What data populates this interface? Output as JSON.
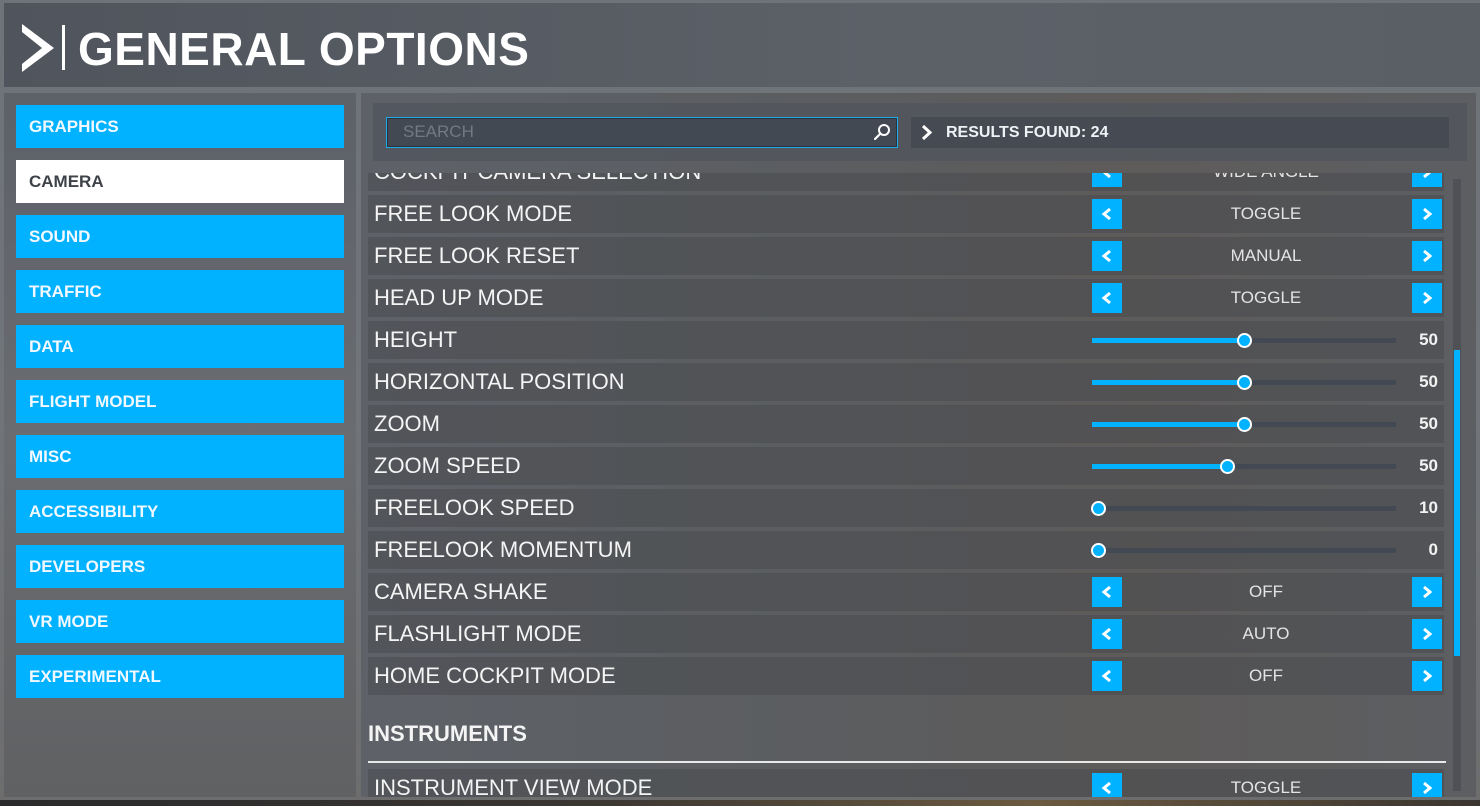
{
  "header": {
    "title": "GENERAL OPTIONS",
    "icon": "chevron-right-icon"
  },
  "sidebar": {
    "items": [
      {
        "label": "GRAPHICS",
        "active": false
      },
      {
        "label": "CAMERA",
        "active": true
      },
      {
        "label": "SOUND",
        "active": false
      },
      {
        "label": "TRAFFIC",
        "active": false
      },
      {
        "label": "DATA",
        "active": false
      },
      {
        "label": "FLIGHT MODEL",
        "active": false
      },
      {
        "label": "MISC",
        "active": false
      },
      {
        "label": "ACCESSIBILITY",
        "active": false
      },
      {
        "label": "DEVELOPERS",
        "active": false
      },
      {
        "label": "VR MODE",
        "active": false
      },
      {
        "label": "EXPERIMENTAL",
        "active": false
      }
    ]
  },
  "search": {
    "placeholder": "SEARCH",
    "value": "",
    "icon": "search-icon"
  },
  "results": {
    "label": "RESULTS FOUND: 24",
    "count": 24
  },
  "settings": [
    {
      "type": "choice",
      "label": "COCKPIT CAMERA SELECTION",
      "value": "WIDE ANGLE",
      "partial": true
    },
    {
      "type": "choice",
      "label": "FREE LOOK MODE",
      "value": "TOGGLE"
    },
    {
      "type": "choice",
      "label": "FREE LOOK RESET",
      "value": "MANUAL"
    },
    {
      "type": "choice",
      "label": "HEAD UP MODE",
      "value": "TOGGLE"
    },
    {
      "type": "slider",
      "label": "HEIGHT",
      "value": "50",
      "fraction": 0.5
    },
    {
      "type": "slider",
      "label": "HORIZONTAL POSITION",
      "value": "50",
      "fraction": 0.5
    },
    {
      "type": "slider",
      "label": "ZOOM",
      "value": "50",
      "fraction": 0.5
    },
    {
      "type": "slider",
      "label": "ZOOM SPEED",
      "value": "50",
      "fraction": 0.445
    },
    {
      "type": "slider",
      "label": "FREELOOK SPEED",
      "value": "10",
      "fraction": 0.02
    },
    {
      "type": "slider",
      "label": "FREELOOK MOMENTUM",
      "value": "0",
      "fraction": 0.02
    },
    {
      "type": "choice",
      "label": "CAMERA SHAKE",
      "value": "OFF"
    },
    {
      "type": "choice",
      "label": "FLASHLIGHT MODE",
      "value": "AUTO"
    },
    {
      "type": "choice",
      "label": "HOME COCKPIT MODE",
      "value": "OFF"
    },
    {
      "type": "section",
      "label": "INSTRUMENTS"
    },
    {
      "type": "choice",
      "label": "INSTRUMENT VIEW MODE",
      "value": "TOGGLE"
    }
  ],
  "scrollbar": {
    "position_fraction": 0.28,
    "visible_fraction": 0.5
  },
  "colors": {
    "accent": "#00b2ff",
    "active_tab_bg": "#ffffff",
    "active_tab_text": "#3e4249"
  }
}
